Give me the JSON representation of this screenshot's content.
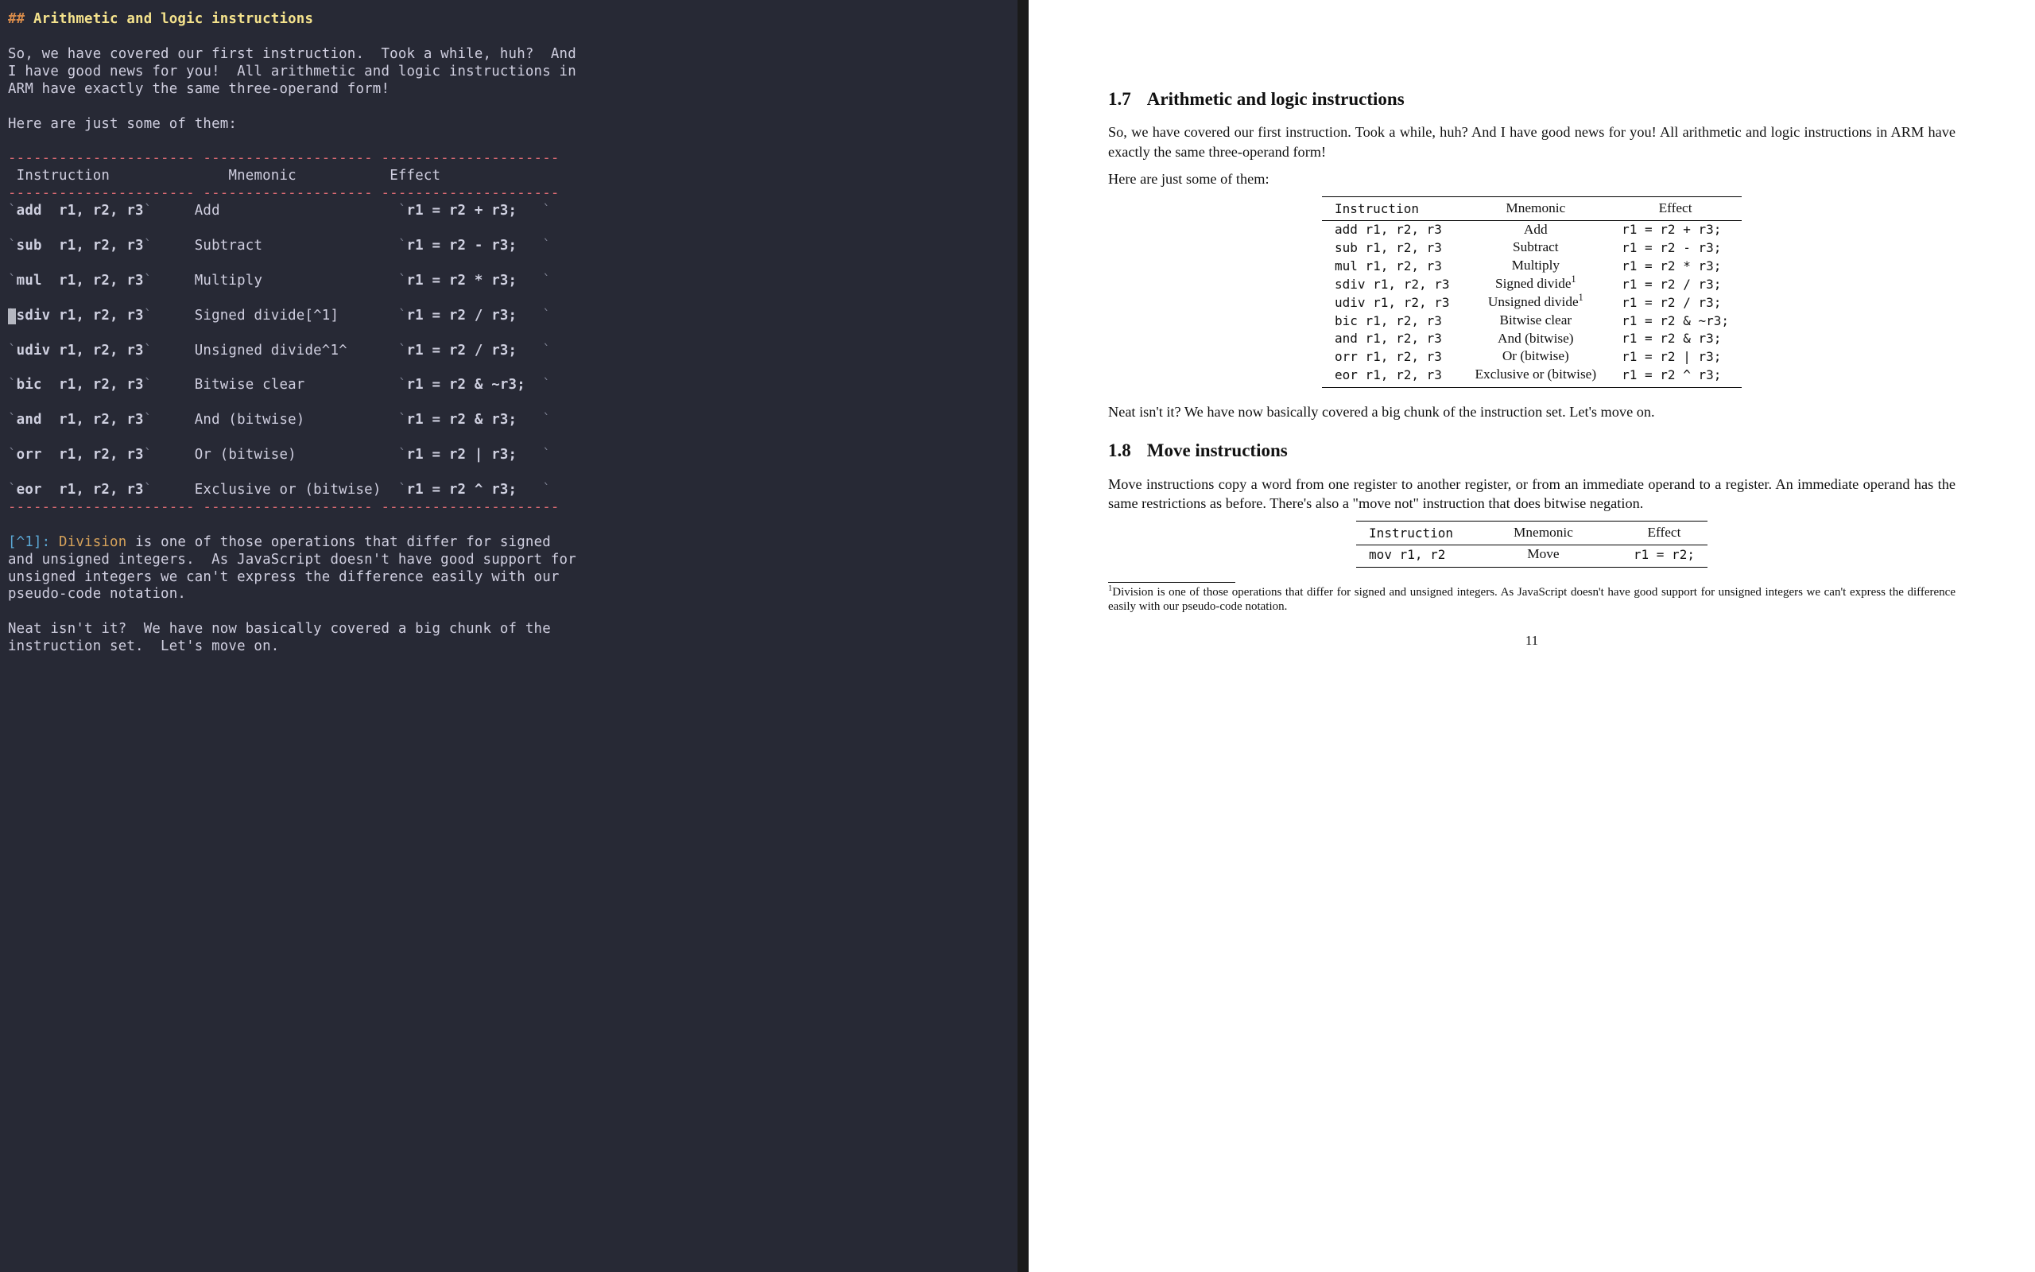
{
  "editor": {
    "heading_hash": "##",
    "heading_text": "Arithmetic and logic instructions",
    "para1_a": "So, we have covered our first instruction.  Took a while, huh?  And",
    "para1_b": "I have good news for you!  All arithmetic and logic instructions in",
    "para1_c": "ARM have exactly the same three-operand form!",
    "para2": "Here are just some of them:",
    "rule": "---------------------- -------------------- ---------------------",
    "th_instr": "Instruction",
    "th_mnem": "Mnemonic",
    "th_effect": "Effect",
    "rule2": "---------------------- -------------------- ---------------------",
    "rows": [
      {
        "instr": "add  r1, r2, r3",
        "mnem": "Add",
        "eff": "r1 = r2 + r3; "
      },
      {
        "instr": "sub  r1, r2, r3",
        "mnem": "Subtract",
        "eff": "r1 = r2 - r3; "
      },
      {
        "instr": "mul  r1, r2, r3",
        "mnem": "Multiply",
        "eff": "r1 = r2 * r3; "
      },
      {
        "instr": "sdiv r1, r2, r3",
        "mnem": "Signed divide[^1]",
        "eff": "r1 = r2 / r3; "
      },
      {
        "instr": "udiv r1, r2, r3",
        "mnem": "Unsigned divide^1^",
        "eff": "r1 = r2 / r3; "
      },
      {
        "instr": "bic  r1, r2, r3",
        "mnem": "Bitwise clear",
        "eff": "r1 = r2 & ~r3;"
      },
      {
        "instr": "and  r1, r2, r3",
        "mnem": "And (bitwise)",
        "eff": "r1 = r2 & r3; "
      },
      {
        "instr": "orr  r1, r2, r3",
        "mnem": "Or (bitwise)",
        "eff": "r1 = r2 | r3; "
      },
      {
        "instr": "eor  r1, r2, r3",
        "mnem": "Exclusive or (bitwise)",
        "eff": "r1 = r2 ^ r3; "
      }
    ],
    "rule3": "---------------------- -------------------- ---------------------",
    "fn_label": "[^1]:",
    "fn_word": "Division",
    "fn_l1": " is one of those operations that differ for signed",
    "fn_l2": "and unsigned integers.  As JavaScript doesn't have good support for",
    "fn_l3": "unsigned integers we can't express the difference easily with our",
    "fn_l4": "pseudo-code notation.",
    "para3_a": "Neat isn't it?  We have now basically covered a big chunk of the",
    "para3_b": "instruction set.  Let's move on."
  },
  "preview": {
    "sec1_num": "1.7",
    "sec1_title": "Arithmetic and logic instructions",
    "p1": "So, we have covered our first instruction. Took a while, huh? And I have good news for you! All arithmetic and logic instruc­tions in ARM have exactly the same three-operand form!",
    "p2": "Here are just some of them:",
    "th_instr": "Instruction",
    "th_mnem": "Mnemonic",
    "th_eff": "Effect",
    "rows": [
      {
        "instr": "add  r1, r2, r3",
        "mnem": "Add",
        "eff": "r1 = r2 + r3;"
      },
      {
        "instr": "sub  r1, r2, r3",
        "mnem": "Subtract",
        "eff": "r1 = r2 - r3;"
      },
      {
        "instr": "mul  r1, r2, r3",
        "mnem": "Multiply",
        "eff": "r1 = r2 * r3;"
      },
      {
        "instr": "sdiv r1, r2, r3",
        "mnem": "Signed divide",
        "sup": "1",
        "eff": "r1 = r2 / r3;"
      },
      {
        "instr": "udiv r1, r2, r3",
        "mnem": "Unsigned divide",
        "sup": "1",
        "eff": "r1 = r2 / r3;"
      },
      {
        "instr": "bic  r1, r2, r3",
        "mnem": "Bitwise clear",
        "eff": "r1 = r2 & ~r3;"
      },
      {
        "instr": "and  r1, r2, r3",
        "mnem": "And (bitwise)",
        "eff": "r1 = r2 & r3;"
      },
      {
        "instr": "orr  r1, r2, r3",
        "mnem": "Or (bitwise)",
        "eff": "r1 = r2 | r3;"
      },
      {
        "instr": "eor  r1, r2, r3",
        "mnem": "Exclusive or (bitwise)",
        "eff": "r1 = r2 ^ r3;"
      }
    ],
    "p3": "Neat isn't it? We have now basically covered a big chunk of the instruction set. Let's move on.",
    "sec2_num": "1.8",
    "sec2_title": "Move instructions",
    "p4": "Move instructions copy a word from one register to another reg­ister, or from an immediate operand to a register. An immedi­ate operand has the same restrictions as before. There's also a \"move not\" instruction that does bitwise negation.",
    "rows2": [
      {
        "instr": "mov r1, r2",
        "mnem": "Move",
        "eff": "r1 = r2;"
      }
    ],
    "fn_sup": "1",
    "fn": "Division is one of those operations that differ for signed and unsigned inte­gers. As JavaScript doesn't have good support for unsigned integers we can't express the difference easily with our pseudo-code notation.",
    "page_num": "11"
  }
}
